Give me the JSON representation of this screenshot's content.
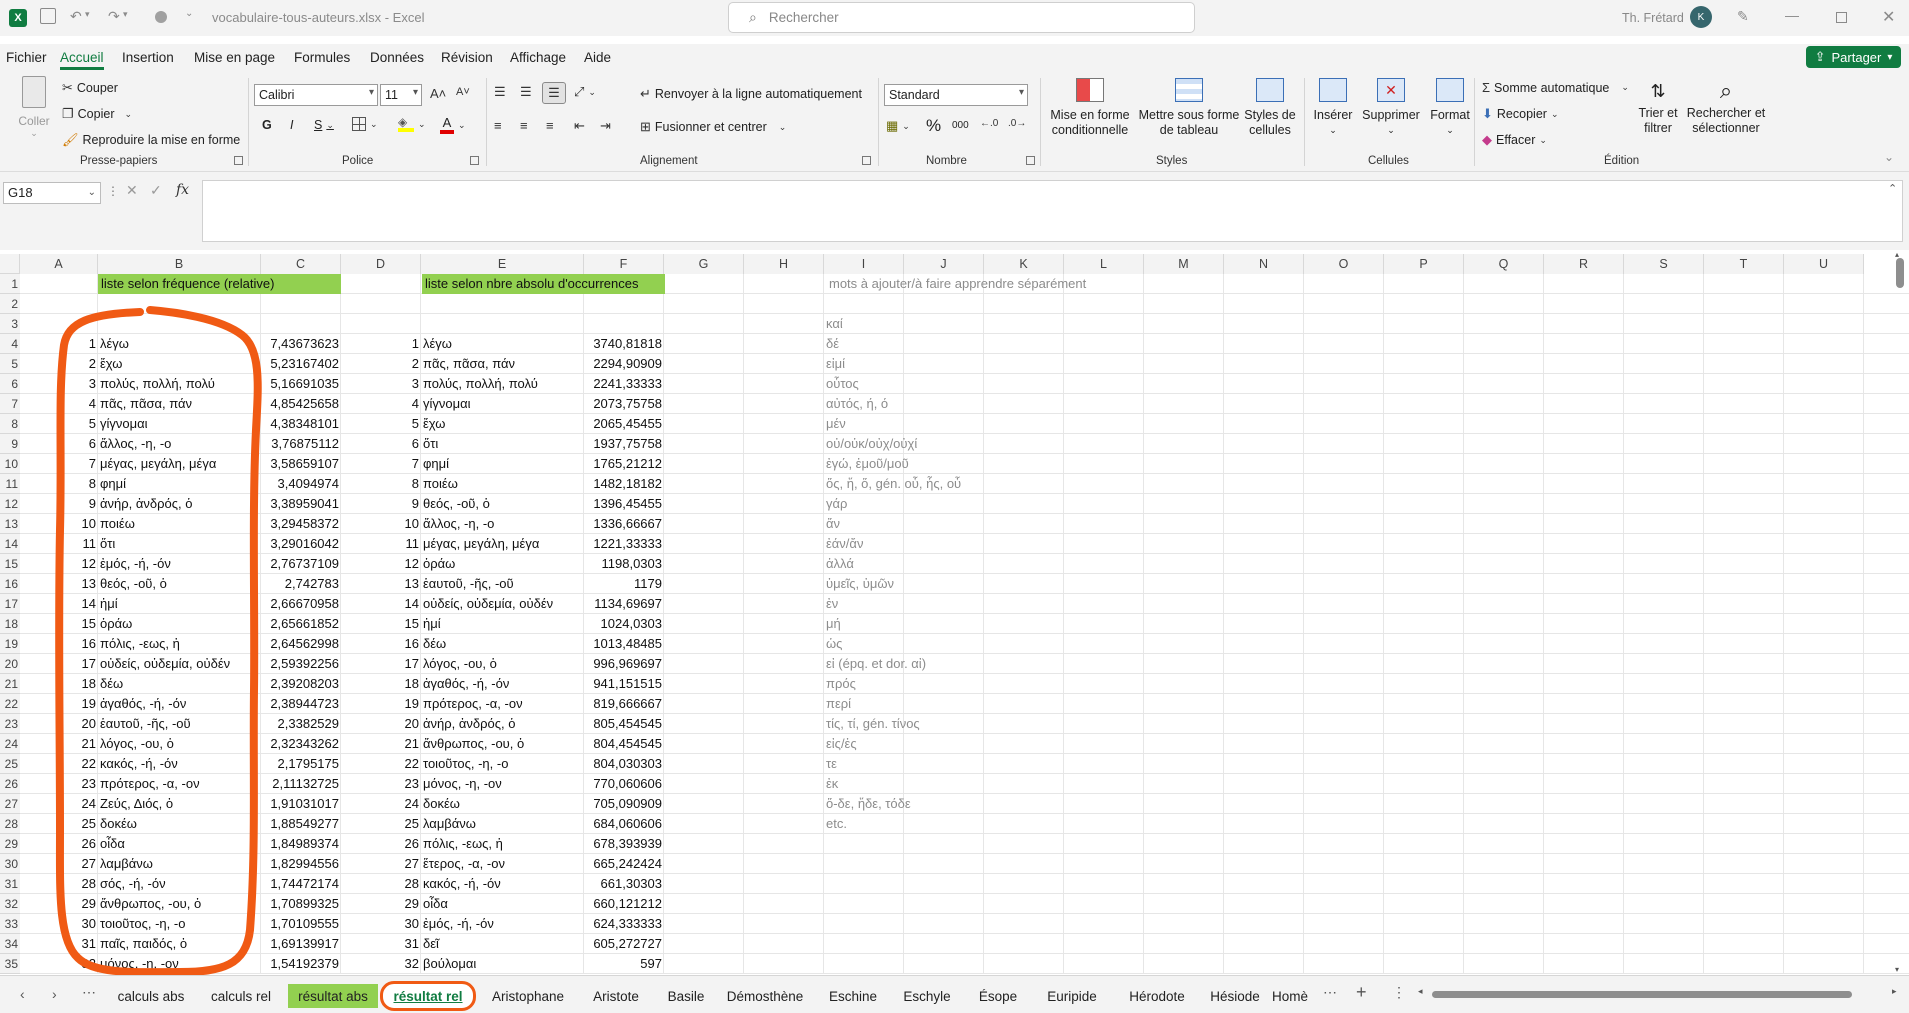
{
  "titlebar": {
    "filename": "vocabulaire-tous-auteurs.xlsx",
    "sep": "-",
    "app": "Excel",
    "search_placeholder": "Rechercher",
    "user": "Th. Frétard",
    "avatar": "K"
  },
  "menu": [
    "Fichier",
    "Accueil",
    "Insertion",
    "Mise en page",
    "Formules",
    "Données",
    "Révision",
    "Affichage",
    "Aide"
  ],
  "share_label": "Partager",
  "ribbon": {
    "clipboard": {
      "paste": "Coller",
      "cut": "Couper",
      "copy": "Copier",
      "format_painter": "Reproduire la mise en forme",
      "label": "Presse-papiers"
    },
    "font": {
      "name": "Calibri",
      "size": "11",
      "bold": "G",
      "italic": "I",
      "underline": "S",
      "label": "Police"
    },
    "alignment": {
      "wrap": "Renvoyer à la ligne automatiquement",
      "merge": "Fusionner et centrer",
      "label": "Alignement"
    },
    "number": {
      "format": "Standard",
      "percent": "%",
      "thousands": "000",
      "label": "Nombre"
    },
    "styles": {
      "conditional": "Mise en forme conditionnelle",
      "table": "Mettre sous forme de tableau",
      "cell_styles": "Styles de cellules",
      "label": "Styles"
    },
    "cells": {
      "insert": "Insérer",
      "delete": "Supprimer",
      "format": "Format",
      "label": "Cellules"
    },
    "editing": {
      "autosum": "Somme automatique",
      "fill": "Recopier",
      "clear": "Effacer",
      "sort": "Trier et filtrer",
      "find": "Rechercher et sélectionner",
      "label": "Édition"
    }
  },
  "formula": {
    "name_box": "G18",
    "fx": "fx",
    "value": ""
  },
  "columns": [
    "A",
    "B",
    "C",
    "D",
    "E",
    "F",
    "G",
    "H",
    "I",
    "J",
    "K",
    "L",
    "M",
    "N",
    "O",
    "P",
    "Q",
    "R",
    "S",
    "T",
    "U"
  ],
  "headers": {
    "b1": "liste selon fréquence (relative)",
    "e1": "liste selon nbre absolu d'occurrences",
    "i1": "mots à ajouter/à faire apprendre séparément"
  },
  "rel_list": [
    {
      "n": "1",
      "word": "λέγω",
      "val": "7,43673623"
    },
    {
      "n": "2",
      "word": "ἔχω",
      "val": "5,23167402"
    },
    {
      "n": "3",
      "word": "πολύς, πολλή, πολύ",
      "val": "5,16691035"
    },
    {
      "n": "4",
      "word": "πᾶς, πᾶσα, πάν",
      "val": "4,85425658"
    },
    {
      "n": "5",
      "word": "γίγνομαι",
      "val": "4,38348101"
    },
    {
      "n": "6",
      "word": "ἄλλος, -η, -ο",
      "val": "3,76875112"
    },
    {
      "n": "7",
      "word": "μέγας, μεγάλη, μέγα",
      "val": "3,58659107"
    },
    {
      "n": "8",
      "word": "φημί",
      "val": "3,4094974"
    },
    {
      "n": "9",
      "word": "ἀνήρ, ἀνδρός, ὁ",
      "val": "3,38959041"
    },
    {
      "n": "10",
      "word": "ποιέω",
      "val": "3,29458372"
    },
    {
      "n": "11",
      "word": "ὅτι",
      "val": "3,29016042"
    },
    {
      "n": "12",
      "word": "ἐμός, -ή, -όν",
      "val": "2,76737109"
    },
    {
      "n": "13",
      "word": "θεός, -οῦ, ὁ",
      "val": "2,742783"
    },
    {
      "n": "14",
      "word": "ἠμί",
      "val": "2,66670958"
    },
    {
      "n": "15",
      "word": "ὁράω",
      "val": "2,65661852"
    },
    {
      "n": "16",
      "word": "πόλις, -εως, ἡ",
      "val": "2,64562998"
    },
    {
      "n": "17",
      "word": "οὐδείς, οὐδεμία, οὐδέν",
      "val": "2,59392256"
    },
    {
      "n": "18",
      "word": "δέω",
      "val": "2,39208203"
    },
    {
      "n": "19",
      "word": "ἀγαθός, -ή, -όν",
      "val": "2,38944723"
    },
    {
      "n": "20",
      "word": "ἑαυτοῦ, -ῆς, -οῦ",
      "val": "2,3382529"
    },
    {
      "n": "21",
      "word": "λόγος, -ου, ὁ",
      "val": "2,32343262"
    },
    {
      "n": "22",
      "word": "κακός, -ή, -όν",
      "val": "2,1795175"
    },
    {
      "n": "23",
      "word": "πρότερος, -α, -ον",
      "val": "2,11132725"
    },
    {
      "n": "24",
      "word": "Ζεύς, Διός, ὁ",
      "val": "1,91031017"
    },
    {
      "n": "25",
      "word": "δοκέω",
      "val": "1,88549277"
    },
    {
      "n": "26",
      "word": "οἶδα",
      "val": "1,84989374"
    },
    {
      "n": "27",
      "word": "λαμβάνω",
      "val": "1,82994556"
    },
    {
      "n": "28",
      "word": "σός, -ή, -όν",
      "val": "1,74472174"
    },
    {
      "n": "29",
      "word": "ἄνθρωπος, -ου, ὁ",
      "val": "1,70899325"
    },
    {
      "n": "30",
      "word": "τοιοῦτος, -η, -ο",
      "val": "1,70109555"
    },
    {
      "n": "31",
      "word": "παῖς, παιδός, ὁ",
      "val": "1,69139917"
    },
    {
      "n": "32",
      "word": "μόνος, -η, -ον",
      "val": "1,54192379"
    }
  ],
  "abs_list": [
    {
      "n": "1",
      "word": "λέγω",
      "val": "3740,81818"
    },
    {
      "n": "2",
      "word": "πᾶς, πᾶσα, πάν",
      "val": "2294,90909"
    },
    {
      "n": "3",
      "word": "πολύς, πολλή, πολύ",
      "val": "2241,33333"
    },
    {
      "n": "4",
      "word": "γίγνομαι",
      "val": "2073,75758"
    },
    {
      "n": "5",
      "word": "ἔχω",
      "val": "2065,45455"
    },
    {
      "n": "6",
      "word": "ὅτι",
      "val": "1937,75758"
    },
    {
      "n": "7",
      "word": "φημί",
      "val": "1765,21212"
    },
    {
      "n": "8",
      "word": "ποιέω",
      "val": "1482,18182"
    },
    {
      "n": "9",
      "word": "θεός, -οῦ, ὁ",
      "val": "1396,45455"
    },
    {
      "n": "10",
      "word": "ἄλλος, -η, -ο",
      "val": "1336,66667"
    },
    {
      "n": "11",
      "word": "μέγας, μεγάλη, μέγα",
      "val": "1221,33333"
    },
    {
      "n": "12",
      "word": "ὁράω",
      "val": "1198,0303"
    },
    {
      "n": "13",
      "word": "ἑαυτοῦ, -ῆς, -οῦ",
      "val": "1179"
    },
    {
      "n": "14",
      "word": "οὐδείς, οὐδεμία, οὐδέν",
      "val": "1134,69697"
    },
    {
      "n": "15",
      "word": "ἠμί",
      "val": "1024,0303"
    },
    {
      "n": "16",
      "word": "δέω",
      "val": "1013,48485"
    },
    {
      "n": "17",
      "word": "λόγος, -ου, ὁ",
      "val": "996,969697"
    },
    {
      "n": "18",
      "word": "ἀγαθός, -ή, -όν",
      "val": "941,151515"
    },
    {
      "n": "19",
      "word": "πρότερος, -α, -ον",
      "val": "819,666667"
    },
    {
      "n": "20",
      "word": "ἀνήρ, ἀνδρός, ὁ",
      "val": "805,454545"
    },
    {
      "n": "21",
      "word": "ἄνθρωπος, -ου, ὁ",
      "val": "804,454545"
    },
    {
      "n": "22",
      "word": "τοιοῦτος, -η, -ο",
      "val": "804,030303"
    },
    {
      "n": "23",
      "word": "μόνος, -η, -ον",
      "val": "770,060606"
    },
    {
      "n": "24",
      "word": "δοκέω",
      "val": "705,090909"
    },
    {
      "n": "25",
      "word": "λαμβάνω",
      "val": "684,060606"
    },
    {
      "n": "26",
      "word": "πόλις, -εως, ἡ",
      "val": "678,393939"
    },
    {
      "n": "27",
      "word": "ἕτερος, -α, -ον",
      "val": "665,242424"
    },
    {
      "n": "28",
      "word": "κακός, -ή, -όν",
      "val": "661,30303"
    },
    {
      "n": "29",
      "word": "οἶδα",
      "val": "660,121212"
    },
    {
      "n": "30",
      "word": "ἐμός, -ή, -όν",
      "val": "624,333333"
    },
    {
      "n": "31",
      "word": "δεῖ",
      "val": "605,272727"
    },
    {
      "n": "32",
      "word": "βούλομαι",
      "val": "597"
    }
  ],
  "extra_words": [
    "καί",
    "δέ",
    "εἰμί",
    "οὗτος",
    "αὐτός, ή, ό",
    "μέν",
    "οὐ/οὐκ/οὐχ/οὐχί",
    "ἐγώ, ἐμοῦ/μοῦ",
    "ὅς, ἥ, ὅ, gén. οὗ, ἧς, οὗ",
    "γάρ",
    "ἄν",
    "ἐάν/ἄν",
    "ἀλλά",
    "ὑμεῖς, ὑμῶν",
    "ἐν",
    "μή",
    "ὡς",
    "εἰ (épq. et dor. αἰ)",
    "πρός",
    "περί",
    "τίς, τί, gén. τίνος",
    "εἰς/ἐς",
    "τε",
    "ἐκ",
    "ὅ-δε, ἥδε, τόδε",
    "etc."
  ],
  "tabs": [
    "calculs abs",
    "calculs rel",
    "résultat abs",
    "résultat rel",
    "Aristophane",
    "Aristote",
    "Basile",
    "Démosthène",
    "Eschine",
    "Eschyle",
    "Ésope",
    "Euripide",
    "Hérodote",
    "Hésiode",
    "Homè"
  ],
  "colors": {
    "accent": "#107c41",
    "header_fill": "#92d050",
    "annotation": "#f05a14",
    "gray_text": "#8c8c8c"
  }
}
